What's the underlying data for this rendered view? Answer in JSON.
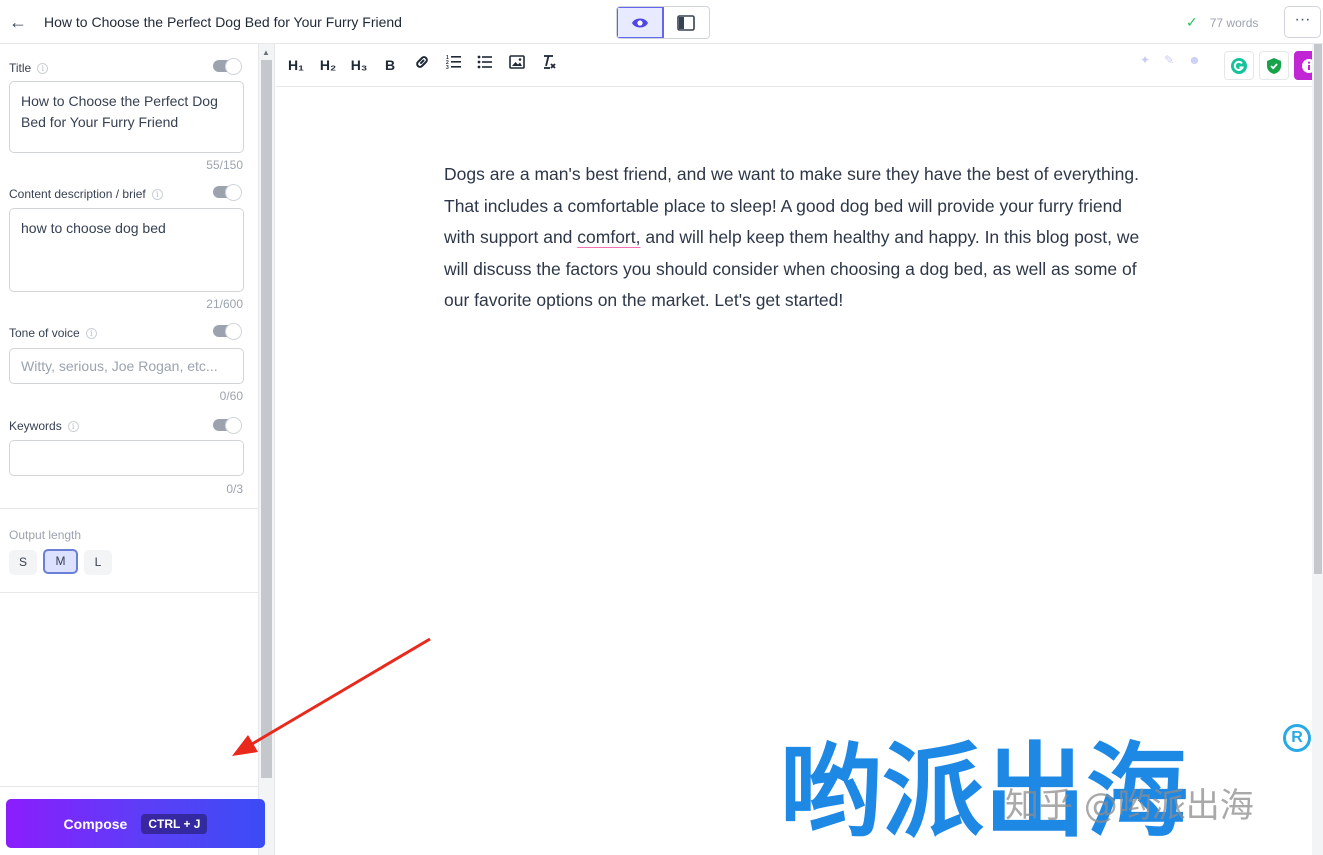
{
  "header": {
    "back_label": "←",
    "title": "How to Choose the Perfect Dog Bed for Your Furry Friend",
    "word_count": "77 words",
    "more_label": "···"
  },
  "sidebar": {
    "title": {
      "label": "Title",
      "value": "How to Choose the Perfect Dog Bed for Your Furry Friend",
      "counter": "55/150"
    },
    "brief": {
      "label": "Content description / brief",
      "value": "how to choose dog bed",
      "counter": "21/600"
    },
    "tone": {
      "label": "Tone of voice",
      "placeholder": "Witty, serious, Joe Rogan, etc...",
      "counter": "0/60"
    },
    "keywords": {
      "label": "Keywords",
      "value": "",
      "counter": "0/3"
    },
    "output_length": {
      "label": "Output length",
      "options": [
        "S",
        "M",
        "L"
      ],
      "selected": "M"
    },
    "compose": {
      "label": "Compose",
      "shortcut": "CTRL + J"
    }
  },
  "toolbar": {
    "h1": "H₁",
    "h2": "H₂",
    "h3": "H₃",
    "bold": "B"
  },
  "editor": {
    "para_before": "Dogs are a man's best friend, and we want to make sure they have the best of everything. That includes a comfortable place to sleep! A good dog bed will provide your furry friend with support and ",
    "para_flagged": "comfort,",
    "para_after": " and will help keep them healthy and happy. In this blog post, we will discuss the factors you should consider when choosing a dog bed, as well as some of our favorite options on the market. Let's get started!"
  },
  "watermark": {
    "brand": "哟派出海",
    "handle": "知乎 @哟派出海",
    "registered": "R"
  },
  "colors": {
    "accent": "#6366f1",
    "compose_gradient_start": "#8b1dfc",
    "compose_gradient_end": "#3b4cf5",
    "check": "#22c55e",
    "grammarly": "#15c39a",
    "shield": "#16a34a",
    "info": "#c026d3",
    "annotation_arrow": "#e8291c",
    "watermark_blue": "#1e88e5"
  }
}
